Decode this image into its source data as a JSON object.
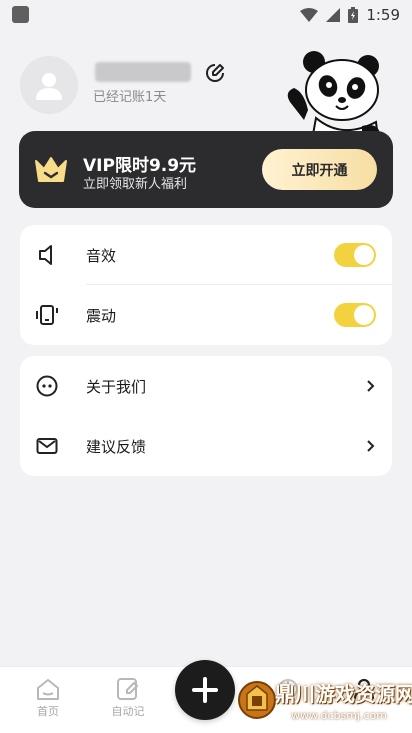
{
  "status_bar": {
    "time": "1:59"
  },
  "profile": {
    "days_text": "已经记账1天"
  },
  "vip": {
    "title": "VIP限时9.9元",
    "subtitle": "立即领取新人福利",
    "button": "立即开通"
  },
  "settings": {
    "sound": {
      "label": "音效",
      "enabled": true
    },
    "vibration": {
      "label": "震动",
      "enabled": true
    }
  },
  "info": {
    "about": {
      "label": "关于我们"
    },
    "feedback": {
      "label": "建议反馈"
    }
  },
  "nav": {
    "home": "首页",
    "auto": "自动记"
  },
  "watermark": {
    "text": "鼎川游戏资源网",
    "url": "www.dcbsmj.com"
  },
  "colors": {
    "accent": "#f2d33f",
    "vip_bg": "#2c2c2e",
    "nav_inactive": "#a7a7ac"
  }
}
